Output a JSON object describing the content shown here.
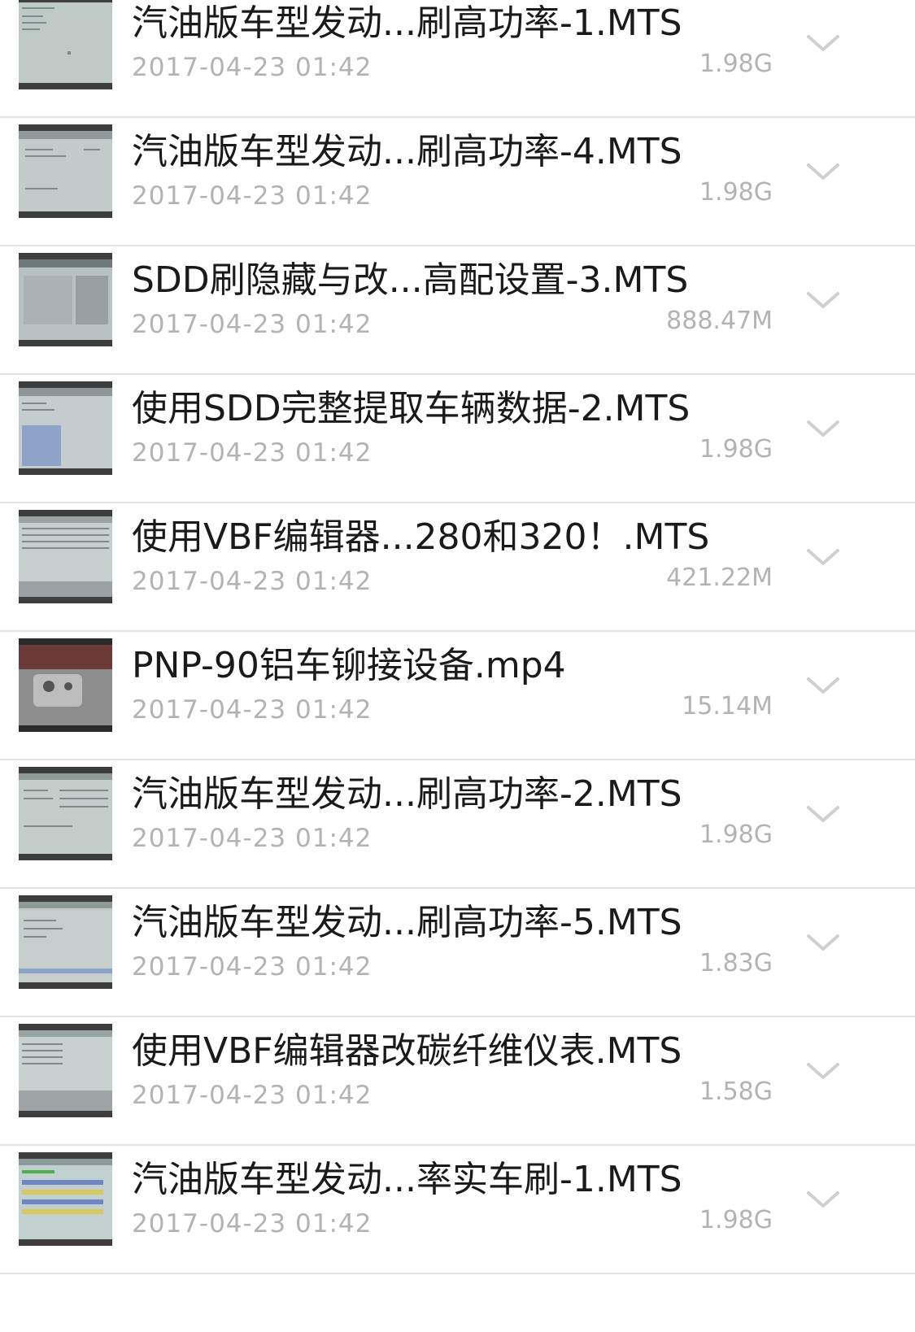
{
  "files": [
    {
      "name": "汽油版车型发动...刷高功率-1.MTS",
      "date": "2017-04-23 01:42",
      "size": "1.98G",
      "thumb": "screen-light"
    },
    {
      "name": "汽油版车型发动...刷高功率-4.MTS",
      "date": "2017-04-23 01:42",
      "size": "1.98G",
      "thumb": "screen-light"
    },
    {
      "name": "SDD刷隐藏与改...高配设置-3.MTS",
      "date": "2017-04-23 01:42",
      "size": "888.47M",
      "thumb": "screen-table"
    },
    {
      "name": "使用SDD完整提取车辆数据-2.MTS",
      "date": "2017-04-23 01:42",
      "size": "1.98G",
      "thumb": "screen-blue"
    },
    {
      "name": "使用VBF编辑器...280和320！.MTS",
      "date": "2017-04-23 01:42",
      "size": "421.22M",
      "thumb": "screen-grid"
    },
    {
      "name": "PNP-90铝车铆接设备.mp4",
      "date": "2017-04-23 01:42",
      "size": "15.14M",
      "thumb": "photo-machine"
    },
    {
      "name": "汽油版车型发动...刷高功率-2.MTS",
      "date": "2017-04-23 01:42",
      "size": "1.98G",
      "thumb": "screen-light"
    },
    {
      "name": "汽油版车型发动...刷高功率-5.MTS",
      "date": "2017-04-23 01:42",
      "size": "1.83G",
      "thumb": "screen-light"
    },
    {
      "name": "使用VBF编辑器改碳纤维仪表.MTS",
      "date": "2017-04-23 01:42",
      "size": "1.58G",
      "thumb": "screen-grid"
    },
    {
      "name": "汽油版车型发动...率实车刷-1.MTS",
      "date": "2017-04-23 01:42",
      "size": "1.98G",
      "thumb": "screen-colorful"
    }
  ],
  "icons": {
    "expand": "chevron-down-icon"
  },
  "colors": {
    "name_text": "#1a1a1a",
    "meta_text": "#b3b3b3",
    "divider": "#e3e3e3",
    "chevron": "#d0d0d0"
  }
}
